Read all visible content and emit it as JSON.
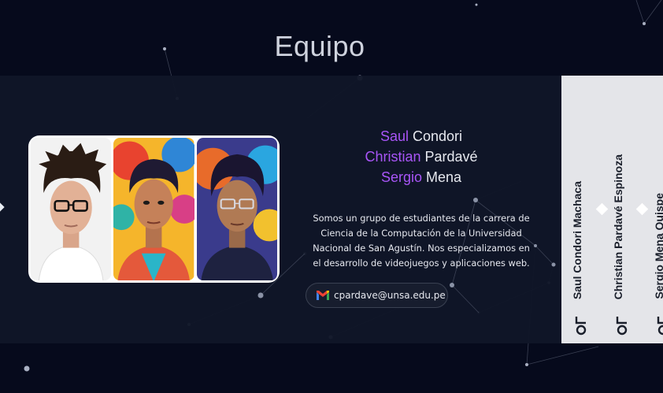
{
  "section": {
    "title": "Equipo"
  },
  "team": {
    "members": [
      {
        "first": "Saul",
        "last": "Condori"
      },
      {
        "first": "Christian",
        "last": "Pardavé"
      },
      {
        "first": "Sergio",
        "last": "Mena"
      }
    ],
    "description_lines": [
      "Somos un grupo de estudiantes de la carrera de",
      "Ciencia de la Computación de la Universidad",
      "Nacional de San Agustín. Nos especializamos en",
      "el desarrollo de videojuegos y aplicaciones web."
    ],
    "email": "cpardave@unsa.edu.pe",
    "email_icon": "gmail-icon"
  },
  "credits": [
    "Saul Condori Machaca",
    "Christian Pardavé Espinoza",
    "Sergio Mena Quispe"
  ],
  "colors": {
    "background": "#060a1c",
    "band": "#101628",
    "accent": "#a855f7",
    "text": "#e6e8ef",
    "panel": "#e4e5e9"
  }
}
